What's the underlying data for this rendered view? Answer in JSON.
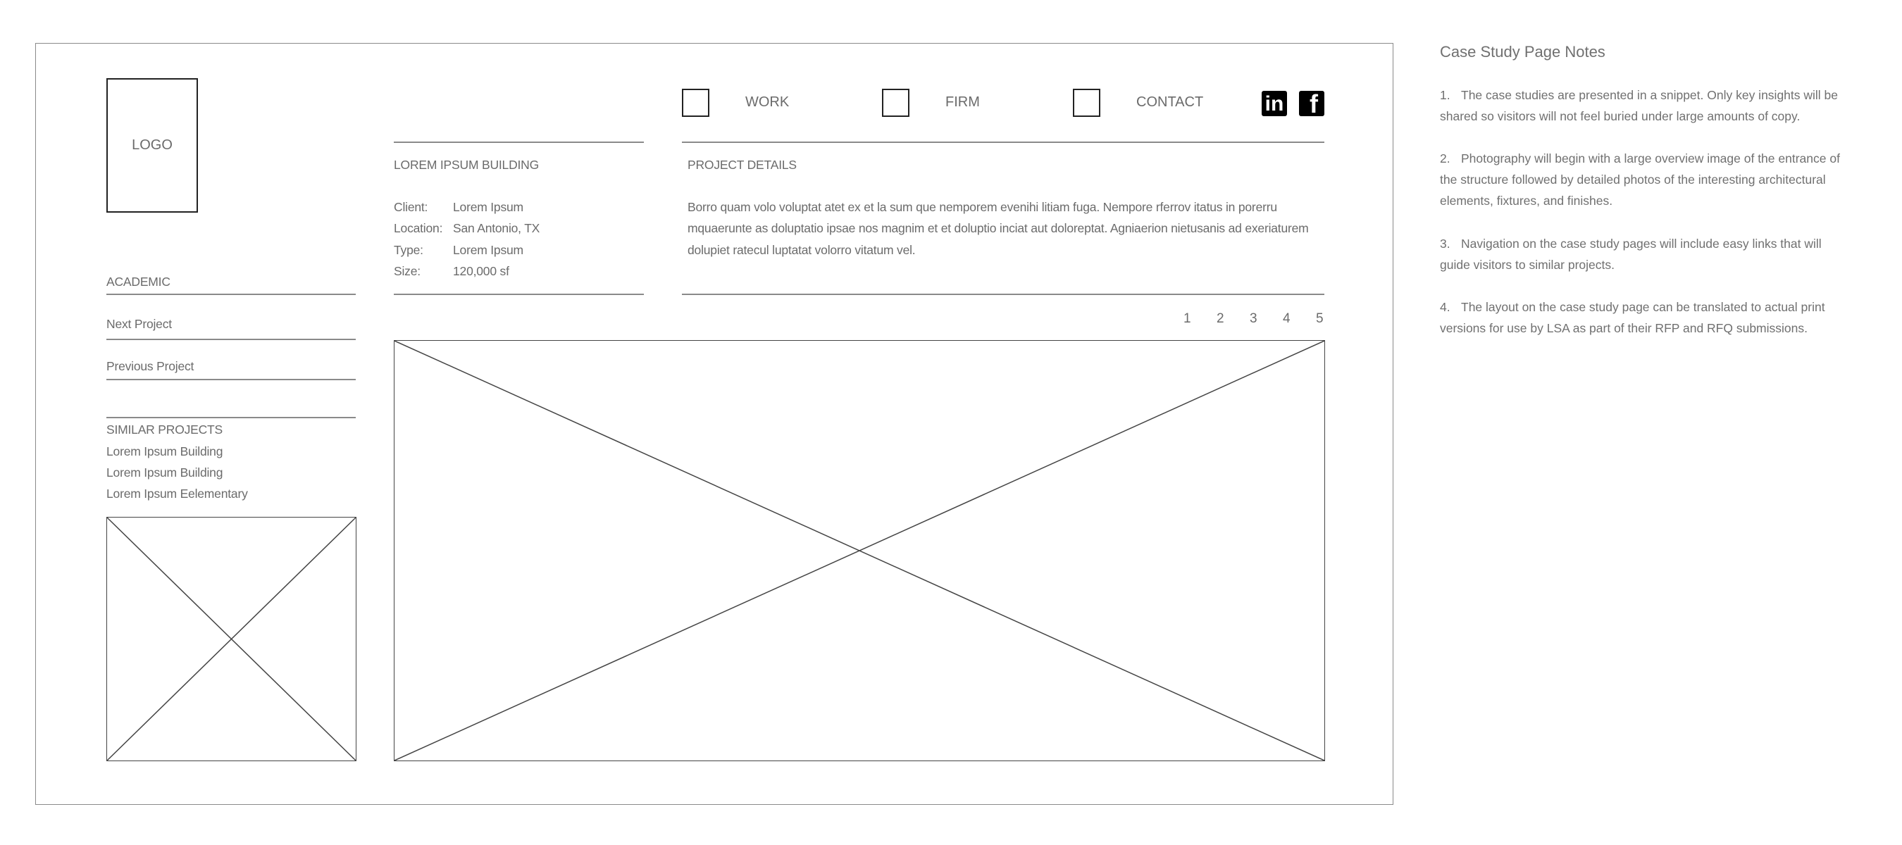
{
  "header": {
    "logo_label": "LOGO",
    "nav": [
      {
        "label": "WORK"
      },
      {
        "label": "FIRM"
      },
      {
        "label": "CONTACT"
      }
    ],
    "social": [
      {
        "icon": "linkedin-icon",
        "glyph": "in"
      },
      {
        "icon": "facebook-icon",
        "glyph": "f"
      }
    ]
  },
  "project": {
    "title": "LOREM IPSUM BUILDING",
    "fields": [
      {
        "label": "Client:",
        "value": "Lorem Ipsum"
      },
      {
        "label": "Location:",
        "value": "San Antonio, TX"
      },
      {
        "label": "Type:",
        "value": "Lorem Ipsum"
      },
      {
        "label": "Size:",
        "value": "120,000 sf"
      }
    ],
    "details_heading": "PROJECT DETAILS",
    "details_lines": [
      "Borro quam volo voluptat atet ex et la sum que nemporem evenihi litiam fuga. Nempore rferrov itatus in porerru",
      "mquaerunte as doluptatio ipsae nos magnim et et doluptio inciat aut doloreptat. Agniaerion nietusanis ad exeriaturem",
      "dolupiet ratecul luptatat volorro vitatum vel."
    ]
  },
  "sidebar": {
    "category": "ACADEMIC",
    "next": "Next Project",
    "previous": "Previous Project",
    "similar_heading": "SIMILAR PROJECTS",
    "similar": [
      "Lorem Ipsum Building",
      "Lorem Ipsum Building",
      "Lorem Ipsum Eelementary"
    ]
  },
  "pagination": [
    "1",
    "2",
    "3",
    "4",
    "5"
  ],
  "notes": {
    "title": "Case Study Page Notes",
    "items": [
      {
        "num": "1.",
        "text": "The case studies are presented in a snippet. Only key insights will be shared so visitors will not feel buried under large amounts of copy."
      },
      {
        "num": "2.",
        "text": "Photography will begin with a large overview image of the entrance of the structure followed by detailed photos of the interesting architectural elements, fixtures, and finishes."
      },
      {
        "num": "3.",
        "text": "Navigation on the case study pages will include easy links that will guide visitors to similar projects."
      },
      {
        "num": "4.",
        "text": "The layout on the case study page can be translated to actual print versions for use by LSA as part of their RFP and RFQ submissions."
      }
    ]
  }
}
